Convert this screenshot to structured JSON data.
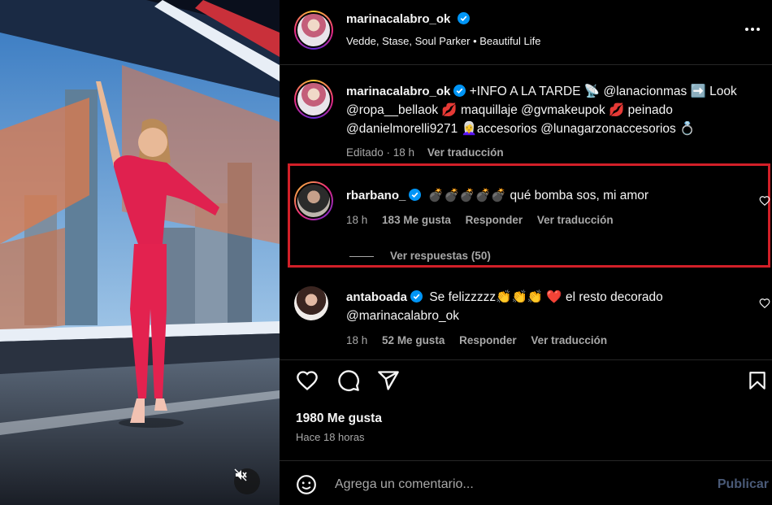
{
  "post": {
    "author": "marinacalabro_ok",
    "audio": "Vedde, Stase, Soul Parker • Beautiful Life",
    "caption_parts": [
      {
        "text": "+INFO A LA TARDE 📡 "
      },
      {
        "text": "@lanacionmas",
        "tag": true
      },
      {
        "text": " ➡️ Look "
      },
      {
        "text": "@ropa__bellaok",
        "tag": true
      },
      {
        "text": " 💋 maquillaje "
      },
      {
        "text": "@gvmakeupok",
        "tag": true
      },
      {
        "text": " 💋 peinado "
      },
      {
        "text": "@danielmorelli9271",
        "tag": true
      },
      {
        "text": " 👩‍🦳accesorios "
      },
      {
        "text": "@lunagarzonaccesorios",
        "tag": true
      },
      {
        "text": " 💍"
      }
    ],
    "caption_edited": "Editado · 18 h",
    "translate_label": "Ver traducción",
    "likes": "1980 Me gusta",
    "time_ago": "Hace 18 horas"
  },
  "comments": [
    {
      "user": "rbarbano_",
      "verified": true,
      "text": "💣💣💣💣💣 qué bomba sos, mi amor",
      "age": "18 h",
      "likes": "183 Me gusta",
      "reply_label": "Responder",
      "translate_label": "Ver traducción",
      "replies_label": "Ver respuestas (50)"
    },
    {
      "user": "antaboada",
      "verified": true,
      "text": "Se felizzzzz👏👏👏 ❤️ el resto decorado",
      "mention": "@marinacalabro_ok",
      "age": "18 h",
      "likes": "52 Me gusta",
      "reply_label": "Responder",
      "translate_label": "Ver traducción"
    }
  ],
  "comment_box": {
    "placeholder": "Agrega un comentario...",
    "publish_label": "Publicar"
  },
  "icons": {
    "verified": "verified-badge-icon",
    "like": "heart-icon",
    "comment": "comment-bubble-icon",
    "share": "paper-plane-icon",
    "save": "bookmark-icon",
    "emoji": "smiley-icon",
    "more": "more-options-icon",
    "mute": "muted-speaker-icon"
  },
  "colors": {
    "background": "#000000",
    "text": "#f5f5f5",
    "secondary": "#a8a8a8",
    "verified": "#0095f6",
    "highlight_border": "#d21f28",
    "publish_disabled": "#4a5a78"
  }
}
